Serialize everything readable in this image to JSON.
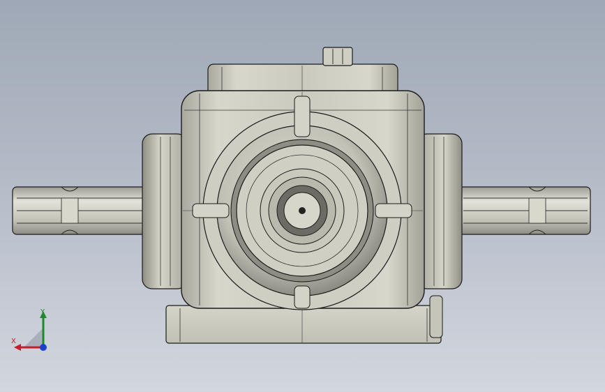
{
  "scene": {
    "type": "cad-model-viewport",
    "object": "right-angle-gearbox",
    "background_colors": [
      "#9fa8b6",
      "#d2d6de"
    ],
    "model_colors": {
      "body": "#c9c8bd",
      "shadow": "#8f8e84",
      "edge": "#1a1a1a"
    }
  },
  "triad": {
    "x_label": "X",
    "y_label": "Y",
    "colors": {
      "x": "#c0202a",
      "y": "#1e8a2c",
      "z": "#1f3fc8"
    }
  }
}
